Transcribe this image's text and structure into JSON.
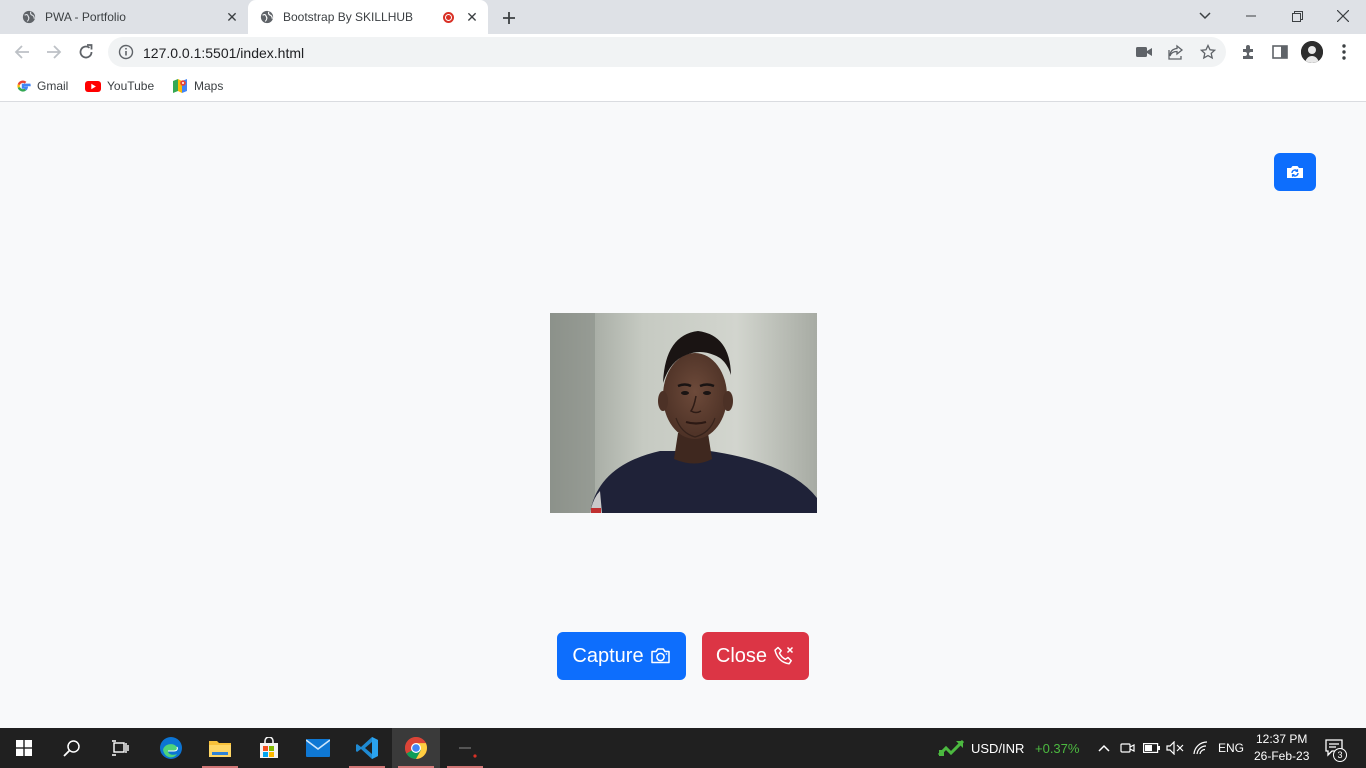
{
  "browser": {
    "tabs": [
      {
        "title": "PWA - Portfolio",
        "active": false
      },
      {
        "title": "Bootstrap By SKILLHUB",
        "active": true,
        "recording": true
      }
    ],
    "address": "127.0.0.1:5501/index.html",
    "bookmarks": [
      {
        "label": "Gmail",
        "icon": "google-icon"
      },
      {
        "label": "YouTube",
        "icon": "youtube-icon"
      },
      {
        "label": "Maps",
        "icon": "maps-icon"
      }
    ]
  },
  "page": {
    "switch_camera_icon": "camera-switch-icon",
    "buttons": {
      "capture_label": "Capture",
      "close_label": "Close"
    },
    "colors": {
      "primary": "#0d6efd",
      "danger": "#dc3545",
      "background": "#f8f9fa"
    }
  },
  "taskbar": {
    "ticker": {
      "symbol": "USD/INR",
      "change": "+0.37%"
    },
    "language": "ENG",
    "time": "12:37 PM",
    "date": "26-Feb-23",
    "notification_count": "3"
  }
}
